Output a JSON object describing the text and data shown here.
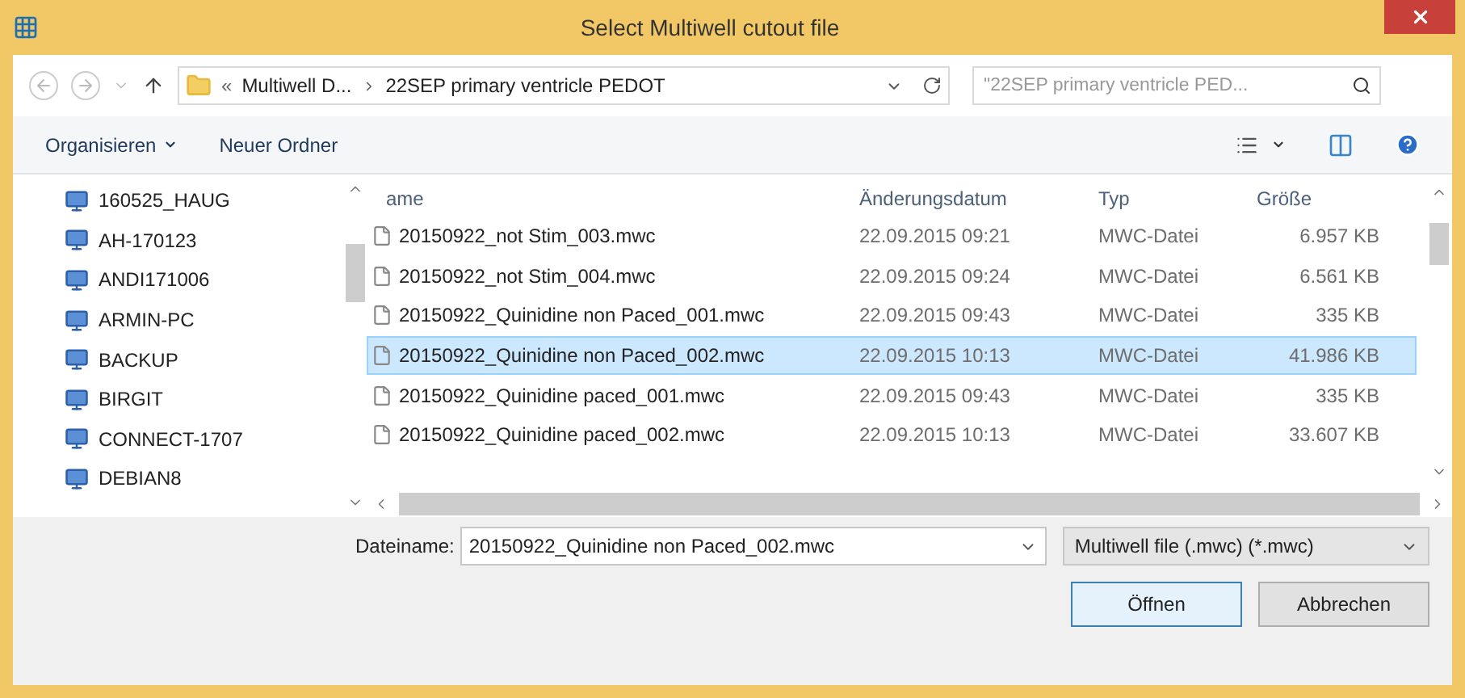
{
  "window": {
    "title": "Select Multiwell cutout file"
  },
  "address": {
    "overflow": "«",
    "crumbs": [
      "Multiwell D...",
      "22SEP primary ventricle PEDOT"
    ]
  },
  "search": {
    "placeholder": "\"22SEP primary ventricle PED..."
  },
  "toolbar": {
    "organize": "Organisieren",
    "new_folder": "Neuer Ordner"
  },
  "nav": {
    "items": [
      {
        "label": "160525_HAUG"
      },
      {
        "label": "AH-170123"
      },
      {
        "label": "ANDI171006"
      },
      {
        "label": "ARMIN-PC"
      },
      {
        "label": "BACKUP"
      },
      {
        "label": "BIRGIT"
      },
      {
        "label": "CONNECT-1707"
      },
      {
        "label": "DEBIAN8"
      }
    ]
  },
  "table": {
    "columns": [
      "ame",
      "Änderungsdatum",
      "Typ",
      "Größe"
    ],
    "rows": [
      {
        "name": "20150922_not Stim_003.mwc",
        "date": "22.09.2015 09:21",
        "type": "MWC-Datei",
        "size": "6.957 KB",
        "selected": false
      },
      {
        "name": "20150922_not Stim_004.mwc",
        "date": "22.09.2015 09:24",
        "type": "MWC-Datei",
        "size": "6.561 KB",
        "selected": false
      },
      {
        "name": "20150922_Quinidine non Paced_001.mwc",
        "date": "22.09.2015 09:43",
        "type": "MWC-Datei",
        "size": "335 KB",
        "selected": false
      },
      {
        "name": "20150922_Quinidine non Paced_002.mwc",
        "date": "22.09.2015 10:13",
        "type": "MWC-Datei",
        "size": "41.986 KB",
        "selected": true
      },
      {
        "name": "20150922_Quinidine paced_001.mwc",
        "date": "22.09.2015 09:43",
        "type": "MWC-Datei",
        "size": "335 KB",
        "selected": false
      },
      {
        "name": "20150922_Quinidine paced_002.mwc",
        "date": "22.09.2015 10:13",
        "type": "MWC-Datei",
        "size": "33.607 KB",
        "selected": false
      }
    ]
  },
  "filename": {
    "label": "Dateiname:",
    "value": "20150922_Quinidine non Paced_002.mwc"
  },
  "filetype": {
    "value": "Multiwell file (.mwc) (*.mwc)"
  },
  "buttons": [
    {
      "label": "Öffnen",
      "default": true
    },
    {
      "label": "Abbrechen",
      "default": false
    }
  ]
}
